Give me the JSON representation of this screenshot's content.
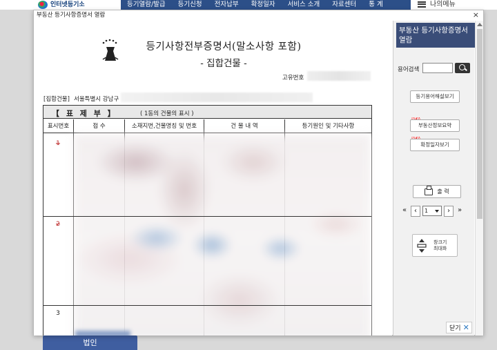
{
  "background": {
    "logo_text": "인터넷등기소",
    "nav": [
      "등기열람/발급",
      "등기신청",
      "전자납부",
      "확정일자",
      "서비스 소개",
      "자료센터",
      "통 계"
    ],
    "my_menu": "나의메뉴",
    "bottom_button": "법인"
  },
  "window": {
    "title": "부동산 등기사항증명서 열람",
    "close": "×"
  },
  "document": {
    "title": "등기사항전부증명서(말소사항 포함)",
    "subtitle": "- 집합건물 -",
    "unique_no_label": "고유번호",
    "building_label": "[집합건물]",
    "building_address": "서울특별시 강남구",
    "section_title": "【  표  제  부  】",
    "section_sub": "( 1동의 건물의 표시 )",
    "columns": [
      "표시번호",
      "접  수",
      "소재지번,건물명칭 및 번호",
      "건 물 내 역",
      "등기원인 및 기타사항"
    ],
    "rows": [
      "1",
      "2",
      "3"
    ]
  },
  "side": {
    "title": "부동산 등기사항증명서 열람",
    "term_search_label": "용어검색",
    "term_search_value": "",
    "glossary_button": "등기용어해설보기",
    "new_tag": "NEW",
    "summary_button": "부동산정보요약",
    "fixed_date_button": "확정일자보기",
    "print_button": "출 력",
    "page_value": "1",
    "zoom_line1": "창크기",
    "zoom_line2": "최대화",
    "close_button": "닫기"
  }
}
